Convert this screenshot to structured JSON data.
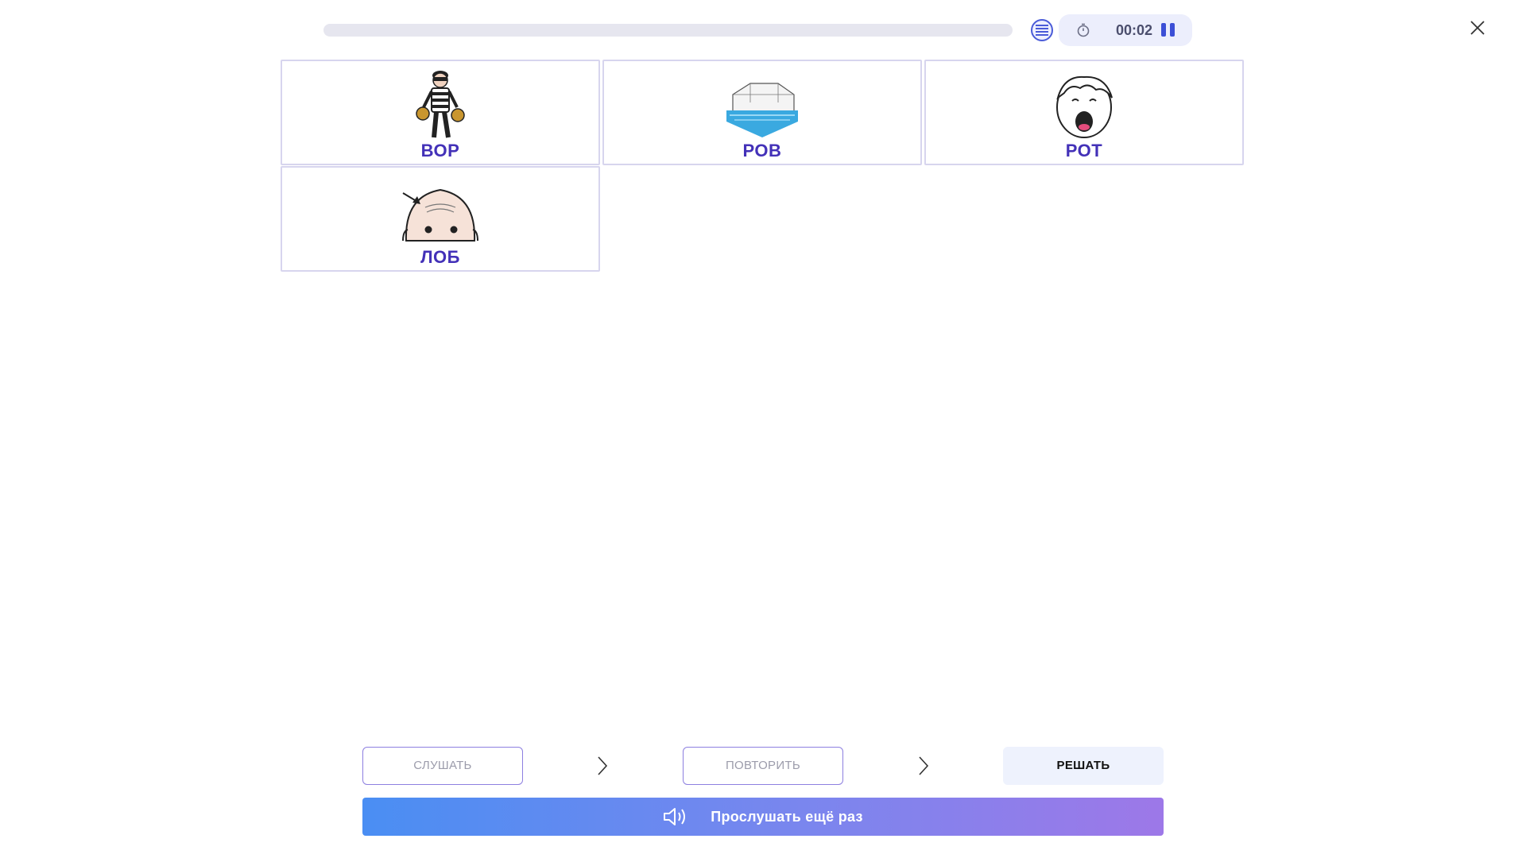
{
  "progress": {
    "value": 0
  },
  "timer": {
    "time": "00:02"
  },
  "cards": [
    {
      "word": "ВОР",
      "icon": "thief-image"
    },
    {
      "word": "РОВ",
      "icon": "moat-image"
    },
    {
      "word": "РОТ",
      "icon": "mouth-image"
    },
    {
      "word": "ЛОБ",
      "icon": "forehead-image"
    }
  ],
  "steps": {
    "listen": "СЛУШАТЬ",
    "repeat": "ПОВТОРИТЬ",
    "solve": "РЕШАТЬ"
  },
  "listen_again": {
    "label": "Прослушать ещё раз",
    "icon": "speaker-icon"
  },
  "colors": {
    "accent": "#4331b8",
    "button_gradient_start": "#4a8ef3",
    "button_gradient_end": "#9d78e8"
  }
}
